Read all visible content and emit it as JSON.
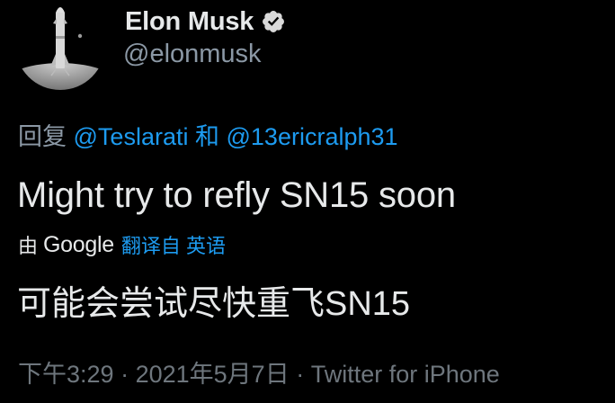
{
  "author": {
    "display_name": "Elon Musk",
    "handle": "@elonmusk",
    "verified": true,
    "avatar_icon": "starship-on-moon-avatar"
  },
  "reply": {
    "prefix": "回复",
    "mention_1": "@Teslarati",
    "conjunction": "和",
    "mention_2": "@13ericralph31"
  },
  "tweet": {
    "text": "Might try to refly SN15 soon",
    "translation_by": "由",
    "translation_provider": "Google",
    "translation_link": "翻译自 英语",
    "translated_text": "可能会尝试尽快重飞SN15"
  },
  "meta": {
    "time": "下午3:29",
    "separator_1": "·",
    "date": "2021年5月7日",
    "separator_2": "·",
    "source": "Twitter for iPhone"
  },
  "colors": {
    "background": "#000000",
    "text": "#e7e9ea",
    "secondary": "#8b98a5",
    "link": "#1d9bf0",
    "verified_badge": "#d9d9d9"
  }
}
